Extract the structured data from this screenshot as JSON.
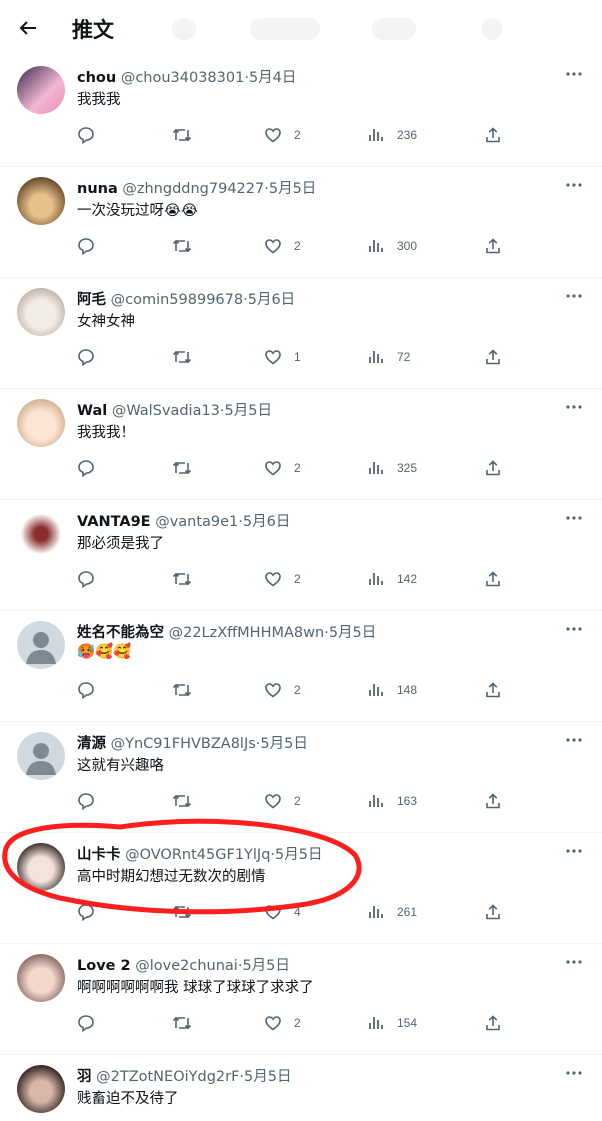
{
  "header": {
    "title": "推文"
  },
  "tweets": [
    {
      "name": "chou",
      "handle": "@chou34038301",
      "date": "5月4日",
      "text": "我我我",
      "likes": "2",
      "views": "236"
    },
    {
      "name": "nuna",
      "handle": "@zhngddng794227",
      "date": "5月5日",
      "text": "一次没玩过呀😭😭",
      "likes": "2",
      "views": "300"
    },
    {
      "name": "阿毛",
      "handle": "@comin59899678",
      "date": "5月6日",
      "text": "女神女神",
      "likes": "1",
      "views": "72"
    },
    {
      "name": "Wal",
      "handle": "@WalSvadia13",
      "date": "5月5日",
      "text": "我我我！",
      "likes": "2",
      "views": "325"
    },
    {
      "name": "VANTA9E",
      "handle": "@vanta9e1",
      "date": "5月6日",
      "text": "那必须是我了",
      "likes": "2",
      "views": "142"
    },
    {
      "name": "姓名不能為空",
      "handle": "@22LzXffMHHMA8wn",
      "date": "5月5日",
      "text": "🥵🥰🥰",
      "likes": "2",
      "views": "148"
    },
    {
      "name": "清源",
      "handle": "@YnC91FHVBZA8lJs",
      "date": "5月5日",
      "text": "这就有兴趣咯",
      "likes": "2",
      "views": "163"
    },
    {
      "name": "山卡卡",
      "handle": "@OVORnt45GF1YlJq",
      "date": "5月5日",
      "text": "高中时期幻想过无数次的剧情",
      "likes": "4",
      "views": "261"
    },
    {
      "name": "Love 2",
      "handle": "@love2chunai",
      "date": "5月5日",
      "text": "啊啊啊啊啊啊我 球球了球球了求求了",
      "likes": "2",
      "views": "154"
    },
    {
      "name": "羽",
      "handle": "@2TZotNEOiYdg2rF",
      "date": "5月5日",
      "text": "贱畜迫不及待了",
      "likes": "",
      "views": ""
    }
  ],
  "dot": "·",
  "colors": {
    "text": "#0f1419",
    "secondary": "#536471",
    "divider": "#eff3f4",
    "annotation": "#ff1e1e"
  },
  "icons": [
    "back-arrow-icon",
    "more-icon",
    "reply-icon",
    "retweet-icon",
    "like-icon",
    "views-icon",
    "share-icon"
  ]
}
